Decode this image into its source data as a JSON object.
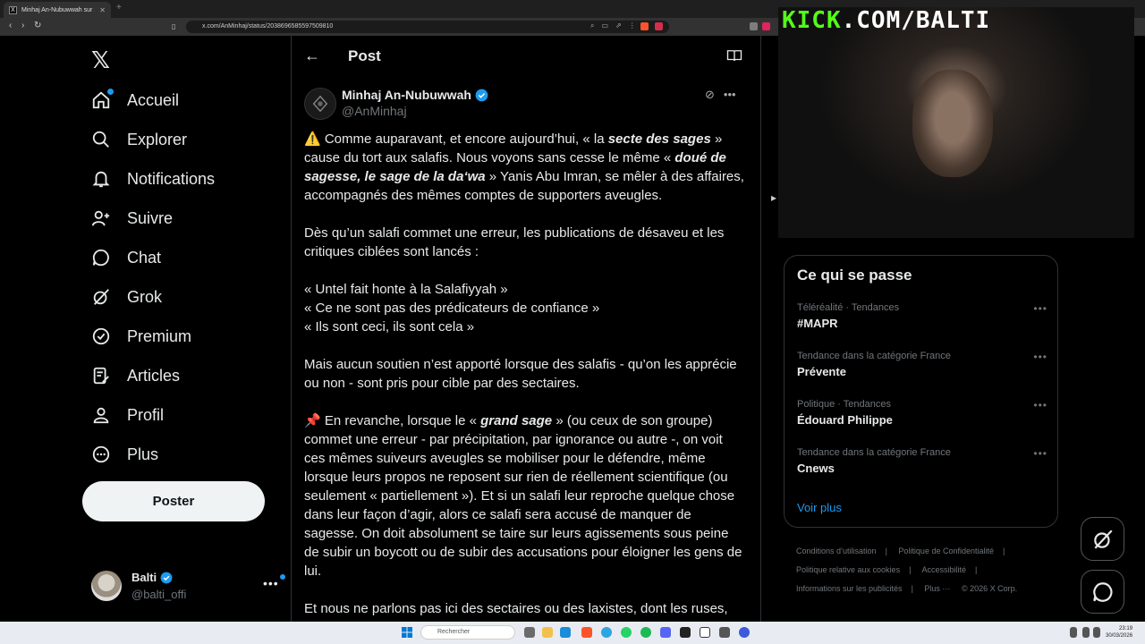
{
  "browser": {
    "tab_title": "Minhaj An-Nubuwwah sur X : \"⚠",
    "url": "x.com/AnMinhaj/status/2038696585597509810"
  },
  "nav": {
    "items": [
      {
        "label": "Accueil",
        "icon": "home-icon"
      },
      {
        "label": "Explorer",
        "icon": "search-icon"
      },
      {
        "label": "Notifications",
        "icon": "bell-icon"
      },
      {
        "label": "Suivre",
        "icon": "follow-icon"
      },
      {
        "label": "Chat",
        "icon": "chat-icon"
      },
      {
        "label": "Grok",
        "icon": "grok-icon"
      },
      {
        "label": "Premium",
        "icon": "premium-icon"
      },
      {
        "label": "Articles",
        "icon": "articles-icon"
      },
      {
        "label": "Profil",
        "icon": "profile-icon"
      },
      {
        "label": "Plus",
        "icon": "more-icon"
      }
    ],
    "post_button": "Poster",
    "account": {
      "name": "Balti",
      "handle": "@balti_offi"
    }
  },
  "main": {
    "title": "Post",
    "author": {
      "name": "Minhaj An-Nubuwwah",
      "handle": "@AnMinhaj"
    },
    "p1": {
      "a": "⚠️ Comme auparavant, et encore aujourd’hui, « la ",
      "b": "secte des sages",
      "c": " » cause du tort aux salafis. Nous voyons sans cesse le même « ",
      "d": "doué de sagesse, le sage de la da‘wa",
      "e": " » Yanis Abu Imran, se mêler à des affaires, accompagnés des mêmes comptes de supporters aveugles."
    },
    "p2": "Dès qu’un salafi commet une erreur, les publications de désaveu et les critiques ciblées sont lancés :",
    "quotes": [
      "« Untel fait honte à la Salafiyyah »",
      "« Ce ne sont pas des prédicateurs de confiance »",
      "« Ils sont ceci, ils sont cela »"
    ],
    "p3": "Mais aucun soutien n’est apporté lorsque des salafis - qu’on les apprécie ou non - sont pris pour cible par des sectaires.",
    "p4": {
      "a": "📌 En revanche, lorsque le « ",
      "b": "grand sage",
      "c": " » (ou ceux de son groupe) commet une erreur - par précipitation, par ignorance ou autre -, on voit ces mêmes suiveurs aveugles se mobiliser pour le défendre, même lorsque leurs propos ne reposent sur rien de réellement scientifique (ou seulement « partiellement »). Et si un salafi leur reproche quelque chose dans leur façon d’agir, alors ce salafi sera accusé de manquer de sagesse. On doit absolument se taire sur leurs agissements sous peine de subir un boycott ou de subir des accusations pour éloigner les gens de lui."
    },
    "p5": "Et nous ne parlons pas ici des sectaires ou des laxistes, dont les ruses,"
  },
  "stream": {
    "k": "KICK",
    "rest": ".COM/BALTI"
  },
  "trends": {
    "title": "Ce qui se passe",
    "items": [
      {
        "category": "Téléréalité · Tendances",
        "name": "#MAPR"
      },
      {
        "category": "Tendance dans la catégorie France",
        "name": "Prévente"
      },
      {
        "category": "Politique · Tendances",
        "name": "Édouard Philippe"
      },
      {
        "category": "Tendance dans la catégorie France",
        "name": "Cnews"
      }
    ],
    "more": "Voir plus"
  },
  "footer": {
    "links": [
      "Conditions d’utilisation",
      "|",
      "Politique de Confidentialité",
      "|",
      "Politique relative aux cookies",
      "|",
      "Accessibilité",
      "|",
      "Informations sur les publicités",
      "|",
      "Plus ···",
      "© 2026 X Corp."
    ]
  },
  "taskbar": {
    "search": "Rechercher",
    "time": "23:19",
    "date": "30/03/2026"
  },
  "colors": {
    "accent": "#1d9bf0",
    "kick_green": "#53fc18",
    "background": "#000000"
  }
}
